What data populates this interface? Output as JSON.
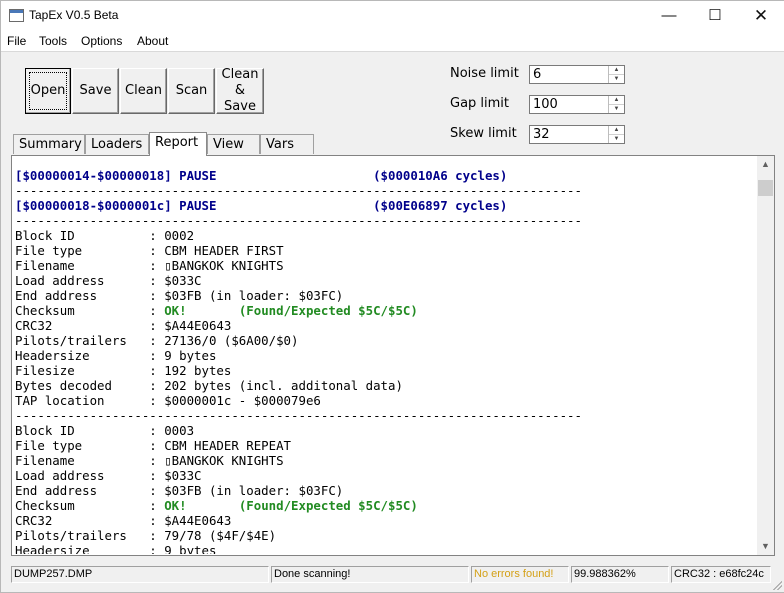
{
  "window": {
    "title": "TapEx V0.5 Beta"
  },
  "menu": [
    "File",
    "Tools",
    "Options",
    "About"
  ],
  "toolbar": {
    "open": "Open",
    "save": "Save",
    "clean": "Clean",
    "scan": "Scan",
    "clean_save": [
      "Clean",
      "&",
      "Save"
    ]
  },
  "limits": {
    "noise": {
      "label": "Noise limit",
      "value": "6"
    },
    "gap": {
      "label": "Gap limit",
      "value": "100"
    },
    "skew": {
      "label": "Skew limit",
      "value": "32"
    }
  },
  "tabs": [
    "Summary",
    "Loaders",
    "Report",
    "View",
    "Vars"
  ],
  "active_tab": "Report",
  "report": {
    "separator": "------------------------------------------------------------------------------",
    "pauses": [
      {
        "range": "[$00000014-$00000018] PAUSE",
        "cycles": "($000010A6 cycles)"
      },
      {
        "range": "[$00000018-$0000001c] PAUSE",
        "cycles": "($00E06897 cycles)"
      }
    ],
    "blocks": [
      {
        "block_id": "0002",
        "file_type": "CBM HEADER FIRST",
        "filename": "▯BANGKOK KNIGHTS",
        "load_address": "$033C",
        "end_address": "$03FB (in loader: $03FC)",
        "checksum_ok": "OK!",
        "checksum_detail": "(Found/Expected $5C/$5C)",
        "crc32": "$A44E0643",
        "pilots_trailers": "27136/0 ($6A00/$0)",
        "headersize": "9 bytes",
        "filesize": "192 bytes",
        "bytes_decoded": "202 bytes (incl. additonal data)",
        "tap_location": "$0000001c - $000079e6"
      },
      {
        "block_id": "0003",
        "file_type": "CBM HEADER REPEAT",
        "filename": "▯BANGKOK KNIGHTS",
        "load_address": "$033C",
        "end_address": "$03FB (in loader: $03FC)",
        "checksum_ok": "OK!",
        "checksum_detail": "(Found/Expected $5C/$5C)",
        "crc32": "$A44E0643",
        "pilots_trailers": "79/78 ($4F/$4E)",
        "headersize": "9 bytes"
      }
    ],
    "field_labels": {
      "block_id": "Block ID",
      "file_type": "File type",
      "filename": "Filename",
      "load_address": "Load address",
      "end_address": "End address",
      "checksum": "Checksum",
      "crc32": "CRC32",
      "pilots_trailers": "Pilots/trailers",
      "headersize": "Headersize",
      "filesize": "Filesize",
      "bytes_decoded": "Bytes decoded",
      "tap_location": "TAP location"
    }
  },
  "status": {
    "file": "DUMP257.DMP",
    "message": "Done scanning!",
    "errors": "No errors found!",
    "percent": "99.988362%",
    "crc": "CRC32 : e68fc24c"
  },
  "colors": {
    "pause": "#00008b",
    "ok": "#228b22",
    "no_errors": "#d4a017"
  },
  "icons": {
    "minimize": "minimize-icon",
    "maximize": "maximize-icon",
    "close": "close-icon",
    "scroll_up": "scroll-up-icon",
    "scroll_down": "scroll-down-icon"
  }
}
